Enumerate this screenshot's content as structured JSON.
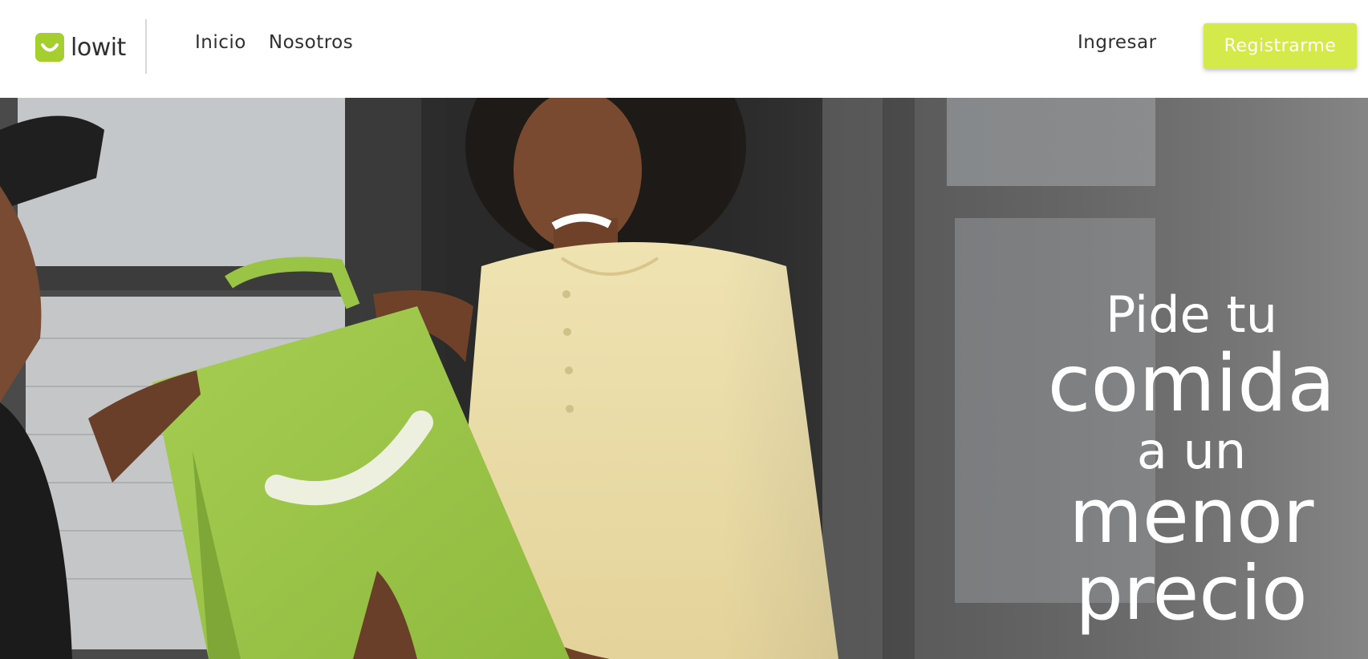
{
  "brand": {
    "name": "lowit",
    "accent_color": "#a4cf2f",
    "icon": "smile-bag-logo-icon"
  },
  "nav": {
    "items": [
      {
        "label": "Inicio"
      },
      {
        "label": "Nosotros"
      }
    ]
  },
  "auth": {
    "login_label": "Ingresar",
    "register_label": "Registrarme",
    "register_color": "#d4e94a"
  },
  "hero": {
    "headline": {
      "line1": "Pide tu",
      "line2": "comida",
      "line3": "a un",
      "line4": "menor",
      "line5": "precio"
    },
    "image": "delivery-person-handing-green-bag-photo"
  }
}
